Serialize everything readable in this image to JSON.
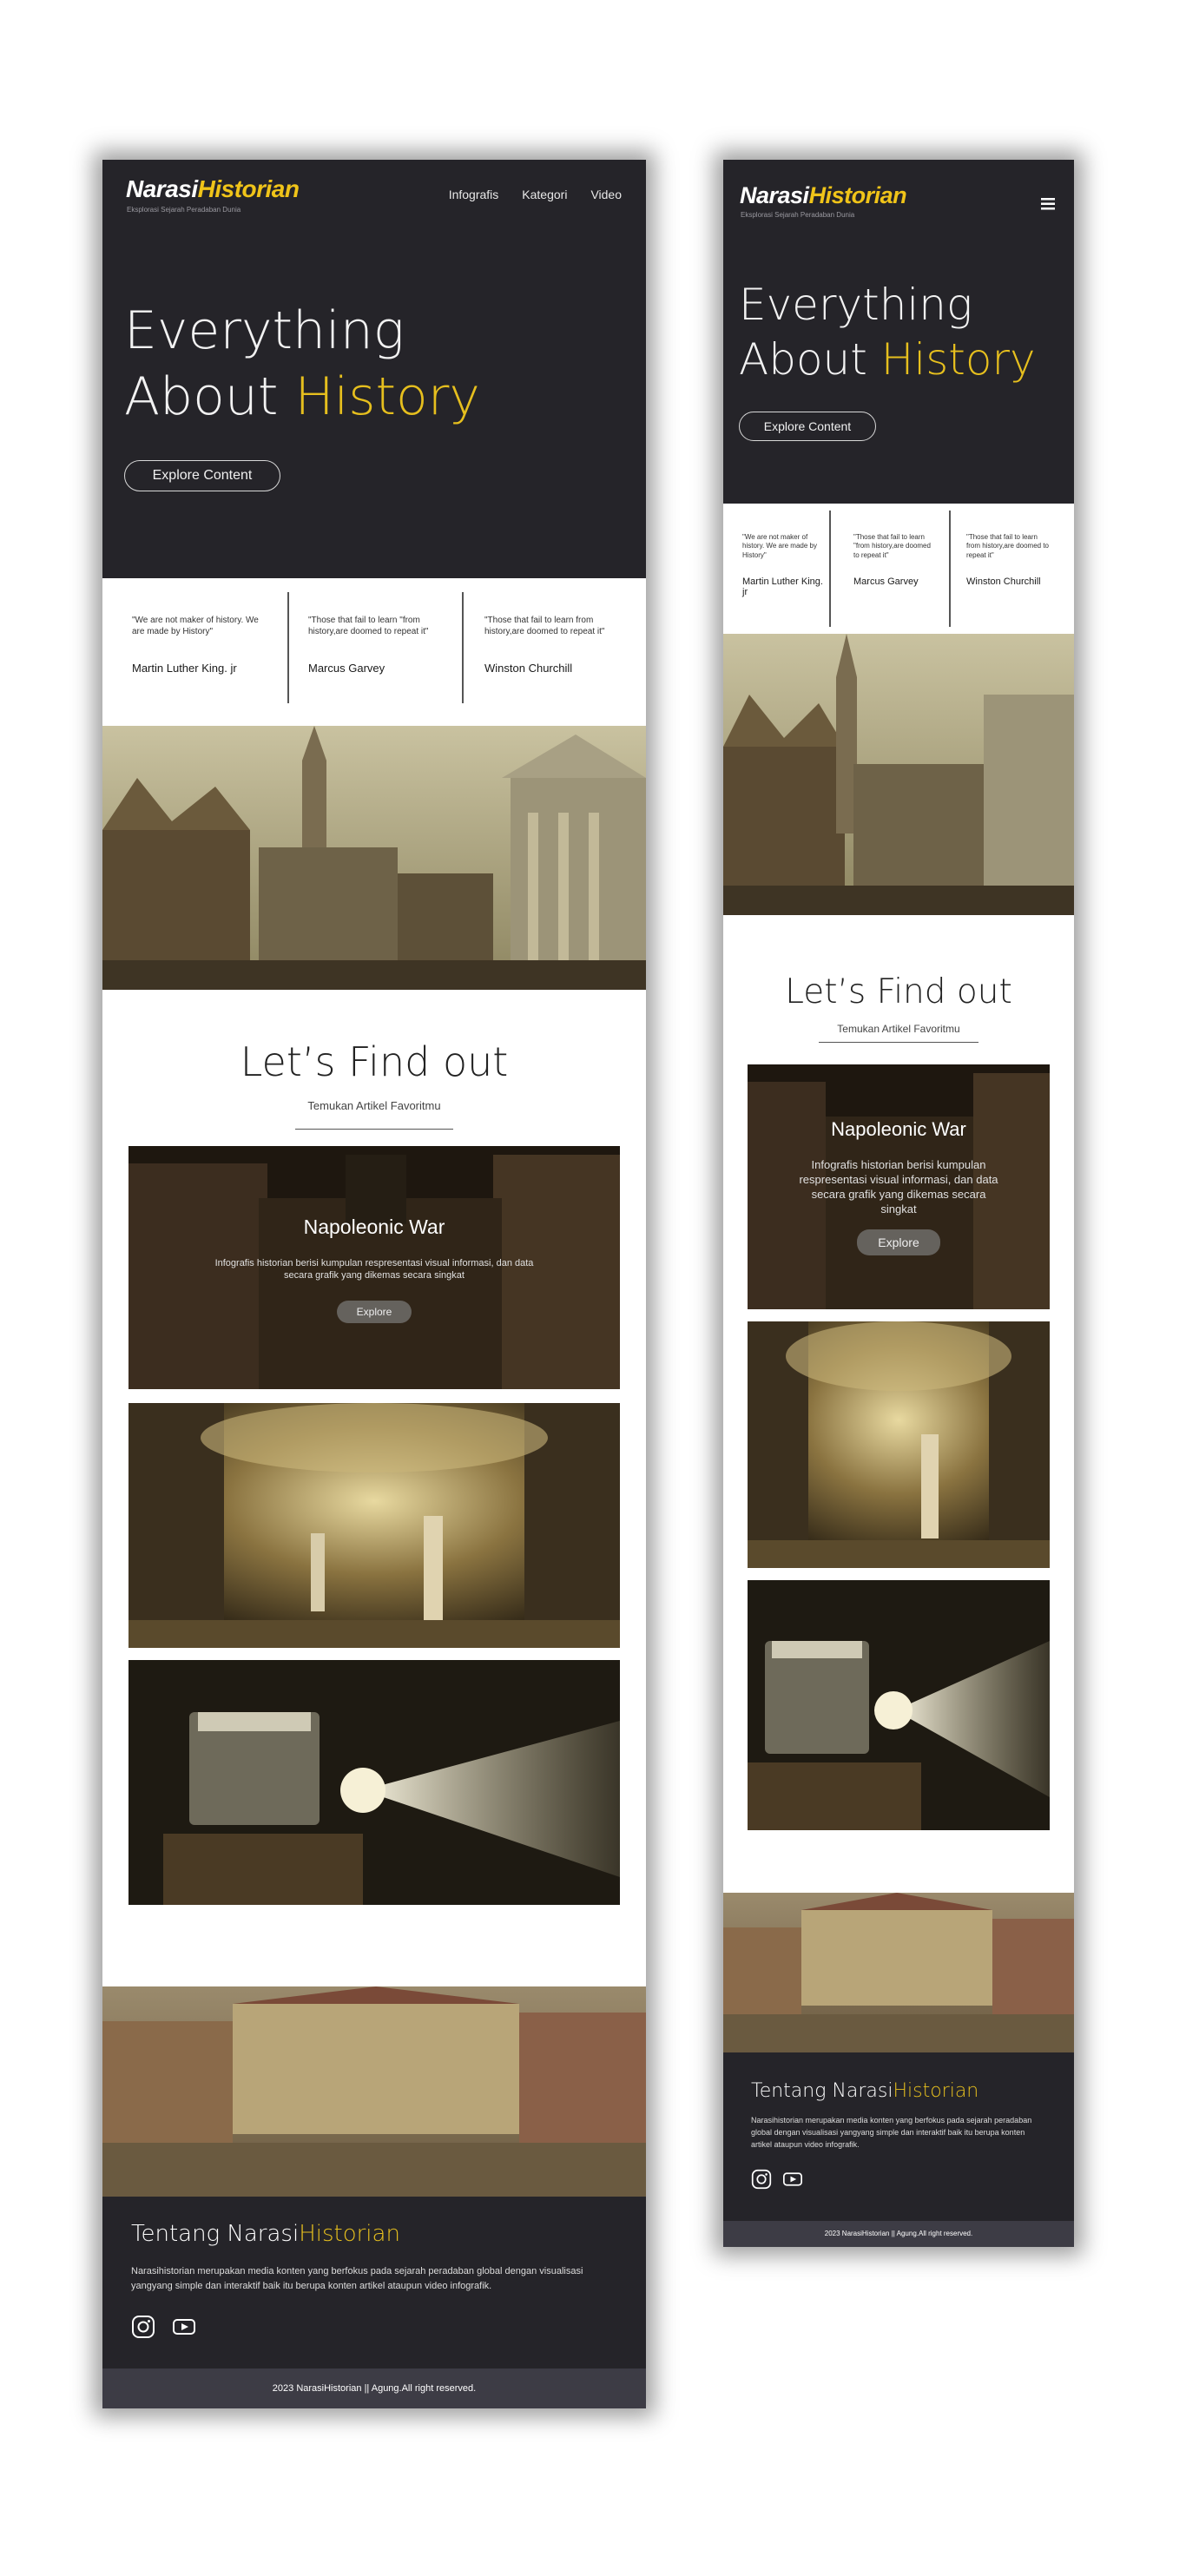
{
  "brand": {
    "logo_part1": "Narasi",
    "logo_part2": "Historian",
    "tagline": "Eksplorasi Sejarah Peradaban Dunia"
  },
  "nav": {
    "items": [
      "Infografis",
      "Kategori",
      "Video"
    ],
    "menu_icon": "hamburger-icon"
  },
  "hero": {
    "line1": "Everything",
    "line2_plain": "About ",
    "line2_accent": "History",
    "cta": "Explore Content"
  },
  "quotes": [
    {
      "text": "\"We are not maker of history. We are made by History\"",
      "author": "Martin Luther King. jr"
    },
    {
      "text": "\"Those that fail to learn \"from history,are doomed to repeat it\"",
      "author": "Marcus Garvey"
    },
    {
      "text": "\"Those that fail to learn from history,are doomed to repeat it\"",
      "author": "Winston Churchill"
    }
  ],
  "find": {
    "title": "Let’s Find out",
    "subtitle": "Temukan Artikel Favoritmu"
  },
  "card": {
    "title": "Napoleonic War",
    "desc": "Infografis historian berisi kumpulan respresentasi visual informasi, dan data secara grafik yang dikemas secara singkat",
    "button": "Explore"
  },
  "about": {
    "title_plain": "Tentang Narasi",
    "title_accent": "Historian",
    "desc": "Narasihistorian merupakan media konten yang berfokus pada sejarah peradaban global dengan visualisasi yangyang simple dan interaktif baik itu berupa konten artikel ataupun video infografik."
  },
  "social": {
    "icons": [
      "instagram-icon",
      "youtube-icon"
    ]
  },
  "footer": {
    "copyright": "2023 NarasiHistorian || Agung.All right reserved."
  },
  "colors": {
    "dark": "#252429",
    "accent": "#e6bf1e",
    "footer_bar": "#3d3c45"
  }
}
